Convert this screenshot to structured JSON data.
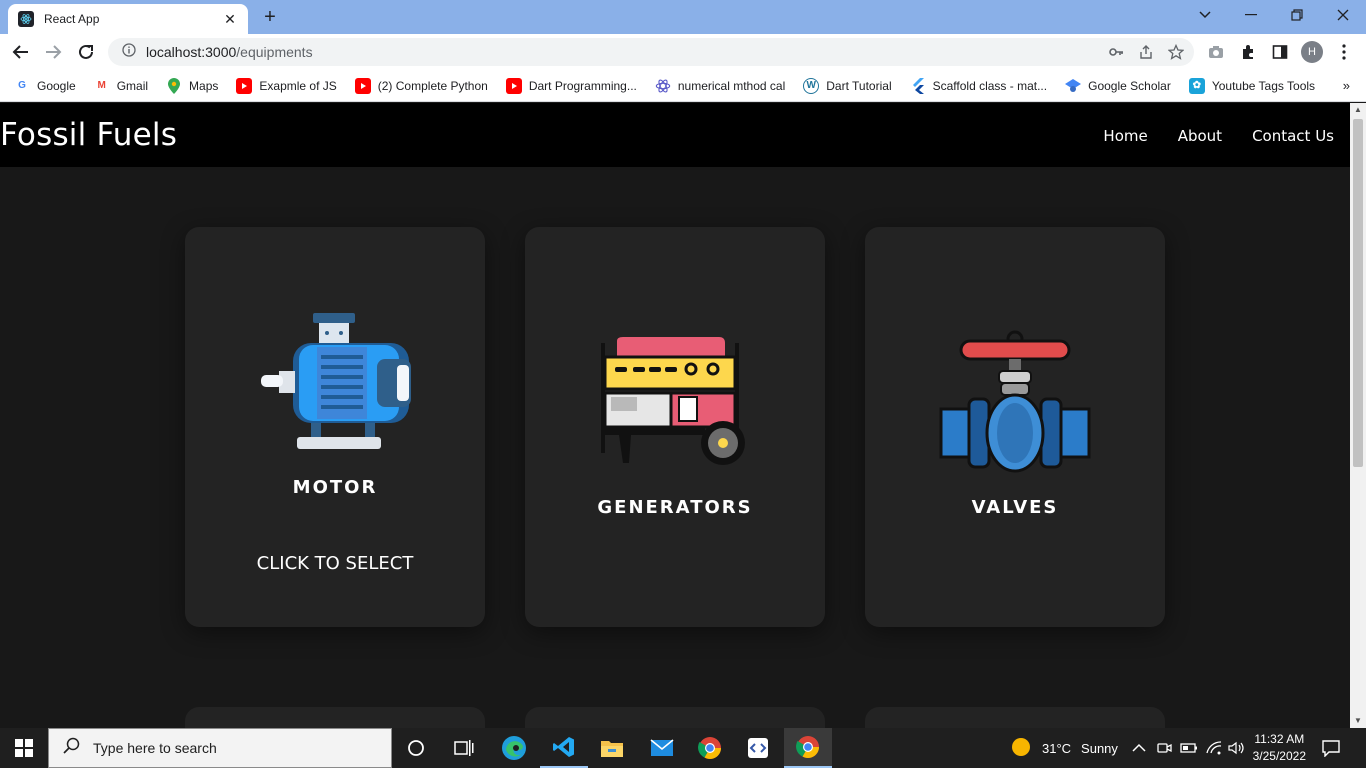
{
  "browser": {
    "tab_title": "React App",
    "url_host": "localhost:3000",
    "url_path": "/equipments",
    "profile_initial": "H"
  },
  "bookmarks": [
    {
      "label": "Google",
      "icon": "google-icon",
      "color": "#4285f4"
    },
    {
      "label": "Gmail",
      "icon": "gmail-icon",
      "color": "#ea4335"
    },
    {
      "label": "Maps",
      "icon": "maps-icon",
      "color": "#34a853"
    },
    {
      "label": "Exapmle of JS",
      "icon": "youtube-icon",
      "color": "#ff0000"
    },
    {
      "label": "(2) Complete Python",
      "icon": "youtube-icon",
      "color": "#ff0000"
    },
    {
      "label": "Dart Programming...",
      "icon": "youtube-icon",
      "color": "#ff0000"
    },
    {
      "label": "numerical mthod cal",
      "icon": "react-icon",
      "color": "#5a5ac8"
    },
    {
      "label": "Dart Tutorial",
      "icon": "wordpress-icon",
      "color": "#21759b"
    },
    {
      "label": "Scaffold class - mat...",
      "icon": "flutter-icon",
      "color": "#42a5f5"
    },
    {
      "label": "Google Scholar",
      "icon": "scholar-icon",
      "color": "#4285f4"
    },
    {
      "label": "Youtube Tags Tools",
      "icon": "tags-icon",
      "color": "#1aa3d9"
    }
  ],
  "page": {
    "brand": "Fossil Fuels",
    "nav": {
      "home": "Home",
      "about": "About",
      "contact": "Contact Us"
    },
    "cards": [
      {
        "label": "MOTOR",
        "cta": "CLICK TO SELECT",
        "icon": "motor-icon"
      },
      {
        "label": "GENERATORS",
        "cta": "",
        "icon": "generator-icon"
      },
      {
        "label": "VALVES",
        "cta": "",
        "icon": "valve-icon"
      }
    ]
  },
  "taskbar": {
    "search_placeholder": "Type here to search",
    "weather_temp": "31°C",
    "weather_text": "Sunny",
    "time": "11:32 AM",
    "date": "3/25/2022"
  },
  "colors": {
    "chrome_tabstrip": "#8ab0e8",
    "page_bg": "#181818",
    "card_bg": "#232323",
    "navbar_bg": "#000000"
  }
}
